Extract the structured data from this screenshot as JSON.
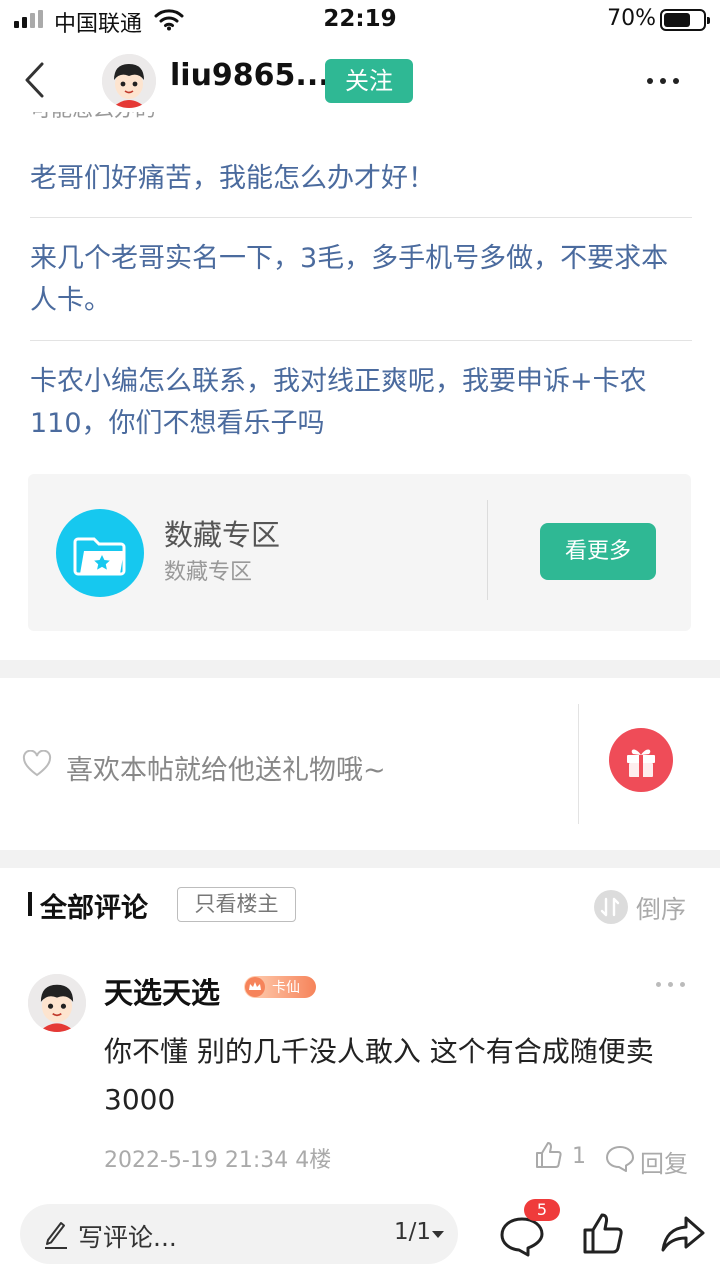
{
  "status_bar": {
    "carrier": "中国联通",
    "time": "22:19",
    "battery_percent": "70%",
    "battery_level": 0.7,
    "icons": [
      "signal-icon",
      "wifi-icon",
      "battery-icon"
    ]
  },
  "nav": {
    "username": "liu9865...",
    "follow_label": "关注",
    "icons": [
      "back-icon",
      "avatar",
      "more-icon"
    ]
  },
  "post": {
    "cut_off_text": "可能怎么办的",
    "links": [
      "老哥们好痛苦，我能怎么办才好！",
      "来几个老哥实名一下，3毛，多手机号多做，不要求本人卡。",
      "卡农小编怎么联系，我对线正爽呢，我要申诉+卡农110，你们不想看乐子吗"
    ],
    "link_color": "#4b6b9e"
  },
  "topic_card": {
    "title": "数藏专区",
    "subtitle": "数藏专区",
    "button_label": "看更多",
    "icon": "folder-star-icon",
    "icon_color": "#16c8ef"
  },
  "gift": {
    "text": "喜欢本帖就给他送礼物哦~",
    "icons": [
      "heart-icon",
      "gift-icon"
    ],
    "button_color": "#ef4c58"
  },
  "comments": {
    "title": "全部评论",
    "filter_label": "只看楼主",
    "sort_label": "倒序",
    "items": [
      {
        "username": "天选天选",
        "badge": "卡仙",
        "body": "你不懂 别的几千没人敢入 这个有合成随便卖3000",
        "timestamp": "2022-5-19 21:34",
        "floor": "4楼",
        "likes": "1",
        "reply_label": "回复"
      }
    ]
  },
  "bottom_bar": {
    "compose_placeholder": "写评论...",
    "page": "1/1",
    "comment_count": "5",
    "icons": [
      "pen-icon",
      "comment-icon",
      "like-icon",
      "share-icon"
    ]
  },
  "colors": {
    "accent": "#2fb894",
    "badge_red": "#ef3b3b"
  }
}
